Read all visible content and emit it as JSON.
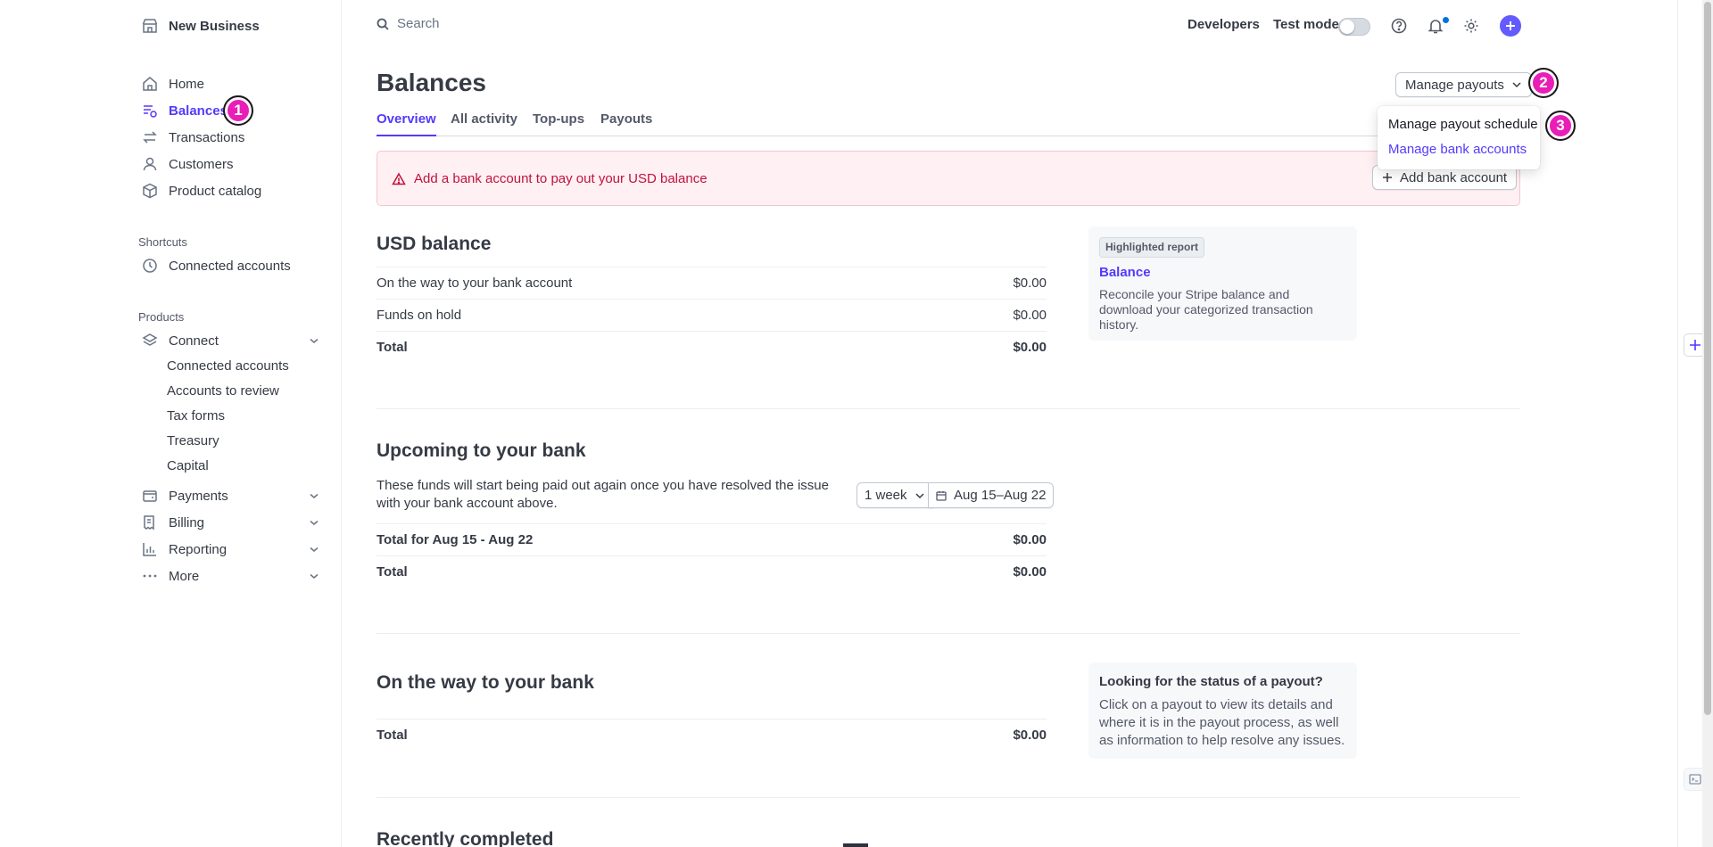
{
  "sidebar": {
    "business_name": "New Business",
    "nav": [
      {
        "label": "Home",
        "icon": "home-icon"
      },
      {
        "label": "Balances",
        "icon": "balances-icon",
        "active": true
      },
      {
        "label": "Transactions",
        "icon": "arrows-swap-icon"
      },
      {
        "label": "Customers",
        "icon": "person-icon"
      },
      {
        "label": "Product catalog",
        "icon": "box-icon"
      }
    ],
    "shortcuts_label": "Shortcuts",
    "shortcut_connected_accounts": "Connected accounts",
    "products_label": "Products",
    "connect": {
      "label": "Connect",
      "children": [
        "Connected accounts",
        "Accounts to review",
        "Tax forms",
        "Treasury",
        "Capital"
      ]
    },
    "payments": "Payments",
    "billing": "Billing",
    "reporting": "Reporting",
    "more": "More"
  },
  "topbar": {
    "search_placeholder": "Search",
    "developers": "Developers",
    "test_mode": "Test mode"
  },
  "badges": {
    "one": "1",
    "two": "2",
    "three": "3"
  },
  "page": {
    "title": "Balances",
    "tabs": [
      "Overview",
      "All activity",
      "Top-ups",
      "Payouts"
    ],
    "manage_payouts": "Manage payouts",
    "menu": {
      "schedule": "Manage payout schedule",
      "bank_accounts": "Manage bank accounts"
    },
    "alert": {
      "text": "Add a bank account to pay out your USD balance",
      "button": "Add bank account"
    },
    "usd_balance": {
      "title": "USD balance",
      "rows": [
        {
          "label": "On the way to your bank account",
          "value": "$0.00"
        },
        {
          "label": "Funds on hold",
          "value": "$0.00"
        },
        {
          "label": "Total",
          "value": "$0.00"
        }
      ]
    },
    "highlighted_report": {
      "tag": "Highlighted report",
      "link": "Balance",
      "text": "Reconcile your Stripe balance and download your categorized transaction history."
    },
    "upcoming": {
      "title": "Upcoming to your bank",
      "description": "These funds will start being paid out again once you have resolved the issue with your bank account above.",
      "period": "1 week",
      "date_range": "Aug 15–Aug 22",
      "rows": [
        {
          "label": "Total for Aug 15 - Aug 22",
          "value": "$0.00"
        },
        {
          "label": "Total",
          "value": "$0.00"
        }
      ]
    },
    "on_the_way": {
      "title": "On the way to your bank",
      "rows": [
        {
          "label": "Total",
          "value": "$0.00"
        }
      ]
    },
    "payout_status": {
      "title": "Looking for the status of a payout?",
      "text": "Click on a payout to view its details and where it is in the payout process, as well as information to help resolve any issues."
    },
    "recently_completed": {
      "title": "Recently completed"
    }
  },
  "colors": {
    "accent": "#533afd",
    "alert": "#c0123c",
    "badge": "#e91eb8"
  }
}
